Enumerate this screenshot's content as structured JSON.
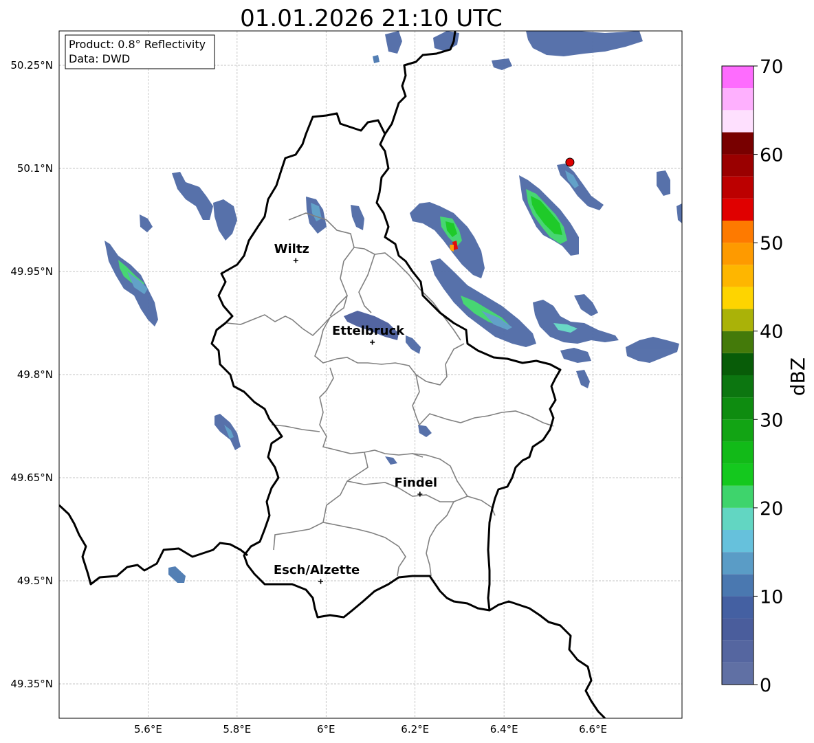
{
  "title": "01.01.2026 21:10 UTC",
  "info_box": {
    "product": "Product: 0.8° Reflectivity",
    "data": "Data: DWD"
  },
  "map": {
    "lon_range": [
      5.4,
      6.8
    ],
    "lat_range": [
      49.3,
      50.3
    ],
    "lat_ticks": [
      "50.25°N",
      "50.1°N",
      "49.95°N",
      "49.8°N",
      "49.65°N",
      "49.5°N",
      "49.35°N"
    ],
    "lat_tick_values": [
      50.25,
      50.1,
      49.95,
      49.8,
      49.65,
      49.5,
      49.35
    ],
    "lon_ticks": [
      "5.6°E",
      "5.8°E",
      "6°E",
      "6.2°E",
      "6.4°E",
      "6.6°E"
    ],
    "lon_tick_values": [
      5.6,
      5.8,
      6.0,
      6.2,
      6.4,
      6.6
    ],
    "grid": true
  },
  "cities": [
    {
      "name": "Wiltz",
      "lon": 5.932,
      "lat": 49.966
    },
    {
      "name": "Ettelbruck",
      "lon": 6.104,
      "lat": 49.847
    },
    {
      "name": "Findel",
      "lon": 6.211,
      "lat": 49.626
    },
    {
      "name": "Esch/Alzette",
      "lon": 5.988,
      "lat": 49.499
    }
  ],
  "marker": {
    "lon": 6.548,
    "lat": 50.109,
    "color": "#e00000"
  },
  "colorbar": {
    "label": "dBZ",
    "min": 0,
    "max": 70,
    "step": 2.5,
    "ticks": [
      "0",
      "10",
      "20",
      "30",
      "40",
      "50",
      "60",
      "70"
    ],
    "tick_values": [
      0,
      10,
      20,
      30,
      40,
      50,
      60,
      70
    ],
    "colors": [
      "#6070a4",
      "#5566a0",
      "#4a5d9c",
      "#4460a2",
      "#4a78b0",
      "#5a9cc6",
      "#66c1dc",
      "#62d6c2",
      "#3ed46c",
      "#14c81e",
      "#12ba18",
      "#12a414",
      "#0e8c10",
      "#0c7610",
      "#085c08",
      "#447a0a",
      "#aab208",
      "#fed400",
      "#feb600",
      "#fe9a00",
      "#fe7a00",
      "#e00000",
      "#bc0000",
      "#9a0000",
      "#780000",
      "#fee0fe",
      "#feb0fe",
      "#fe6cfe",
      "#ee36ee"
    ]
  }
}
